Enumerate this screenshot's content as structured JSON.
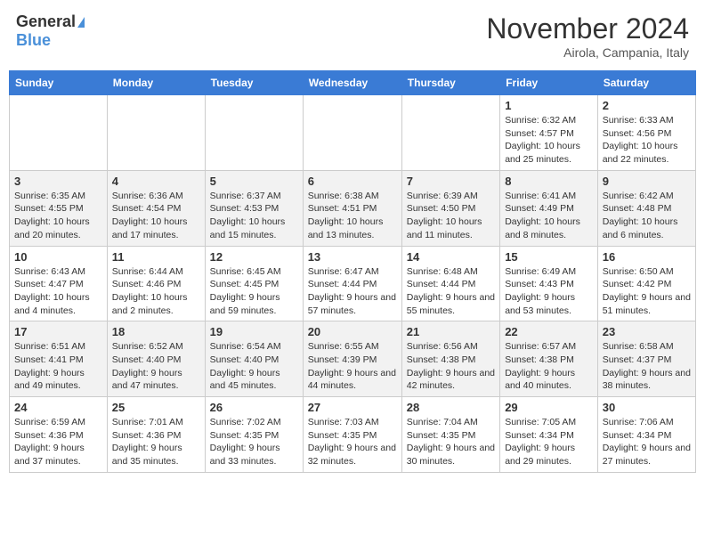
{
  "header": {
    "logo_general": "General",
    "logo_blue": "Blue",
    "month_title": "November 2024",
    "location": "Airola, Campania, Italy"
  },
  "weekdays": [
    "Sunday",
    "Monday",
    "Tuesday",
    "Wednesday",
    "Thursday",
    "Friday",
    "Saturday"
  ],
  "weeks": [
    [
      {
        "day": "",
        "info": ""
      },
      {
        "day": "",
        "info": ""
      },
      {
        "day": "",
        "info": ""
      },
      {
        "day": "",
        "info": ""
      },
      {
        "day": "",
        "info": ""
      },
      {
        "day": "1",
        "info": "Sunrise: 6:32 AM\nSunset: 4:57 PM\nDaylight: 10 hours and 25 minutes."
      },
      {
        "day": "2",
        "info": "Sunrise: 6:33 AM\nSunset: 4:56 PM\nDaylight: 10 hours and 22 minutes."
      }
    ],
    [
      {
        "day": "3",
        "info": "Sunrise: 6:35 AM\nSunset: 4:55 PM\nDaylight: 10 hours and 20 minutes."
      },
      {
        "day": "4",
        "info": "Sunrise: 6:36 AM\nSunset: 4:54 PM\nDaylight: 10 hours and 17 minutes."
      },
      {
        "day": "5",
        "info": "Sunrise: 6:37 AM\nSunset: 4:53 PM\nDaylight: 10 hours and 15 minutes."
      },
      {
        "day": "6",
        "info": "Sunrise: 6:38 AM\nSunset: 4:51 PM\nDaylight: 10 hours and 13 minutes."
      },
      {
        "day": "7",
        "info": "Sunrise: 6:39 AM\nSunset: 4:50 PM\nDaylight: 10 hours and 11 minutes."
      },
      {
        "day": "8",
        "info": "Sunrise: 6:41 AM\nSunset: 4:49 PM\nDaylight: 10 hours and 8 minutes."
      },
      {
        "day": "9",
        "info": "Sunrise: 6:42 AM\nSunset: 4:48 PM\nDaylight: 10 hours and 6 minutes."
      }
    ],
    [
      {
        "day": "10",
        "info": "Sunrise: 6:43 AM\nSunset: 4:47 PM\nDaylight: 10 hours and 4 minutes."
      },
      {
        "day": "11",
        "info": "Sunrise: 6:44 AM\nSunset: 4:46 PM\nDaylight: 10 hours and 2 minutes."
      },
      {
        "day": "12",
        "info": "Sunrise: 6:45 AM\nSunset: 4:45 PM\nDaylight: 9 hours and 59 minutes."
      },
      {
        "day": "13",
        "info": "Sunrise: 6:47 AM\nSunset: 4:44 PM\nDaylight: 9 hours and 57 minutes."
      },
      {
        "day": "14",
        "info": "Sunrise: 6:48 AM\nSunset: 4:44 PM\nDaylight: 9 hours and 55 minutes."
      },
      {
        "day": "15",
        "info": "Sunrise: 6:49 AM\nSunset: 4:43 PM\nDaylight: 9 hours and 53 minutes."
      },
      {
        "day": "16",
        "info": "Sunrise: 6:50 AM\nSunset: 4:42 PM\nDaylight: 9 hours and 51 minutes."
      }
    ],
    [
      {
        "day": "17",
        "info": "Sunrise: 6:51 AM\nSunset: 4:41 PM\nDaylight: 9 hours and 49 minutes."
      },
      {
        "day": "18",
        "info": "Sunrise: 6:52 AM\nSunset: 4:40 PM\nDaylight: 9 hours and 47 minutes."
      },
      {
        "day": "19",
        "info": "Sunrise: 6:54 AM\nSunset: 4:40 PM\nDaylight: 9 hours and 45 minutes."
      },
      {
        "day": "20",
        "info": "Sunrise: 6:55 AM\nSunset: 4:39 PM\nDaylight: 9 hours and 44 minutes."
      },
      {
        "day": "21",
        "info": "Sunrise: 6:56 AM\nSunset: 4:38 PM\nDaylight: 9 hours and 42 minutes."
      },
      {
        "day": "22",
        "info": "Sunrise: 6:57 AM\nSunset: 4:38 PM\nDaylight: 9 hours and 40 minutes."
      },
      {
        "day": "23",
        "info": "Sunrise: 6:58 AM\nSunset: 4:37 PM\nDaylight: 9 hours and 38 minutes."
      }
    ],
    [
      {
        "day": "24",
        "info": "Sunrise: 6:59 AM\nSunset: 4:36 PM\nDaylight: 9 hours and 37 minutes."
      },
      {
        "day": "25",
        "info": "Sunrise: 7:01 AM\nSunset: 4:36 PM\nDaylight: 9 hours and 35 minutes."
      },
      {
        "day": "26",
        "info": "Sunrise: 7:02 AM\nSunset: 4:35 PM\nDaylight: 9 hours and 33 minutes."
      },
      {
        "day": "27",
        "info": "Sunrise: 7:03 AM\nSunset: 4:35 PM\nDaylight: 9 hours and 32 minutes."
      },
      {
        "day": "28",
        "info": "Sunrise: 7:04 AM\nSunset: 4:35 PM\nDaylight: 9 hours and 30 minutes."
      },
      {
        "day": "29",
        "info": "Sunrise: 7:05 AM\nSunset: 4:34 PM\nDaylight: 9 hours and 29 minutes."
      },
      {
        "day": "30",
        "info": "Sunrise: 7:06 AM\nSunset: 4:34 PM\nDaylight: 9 hours and 27 minutes."
      }
    ]
  ]
}
